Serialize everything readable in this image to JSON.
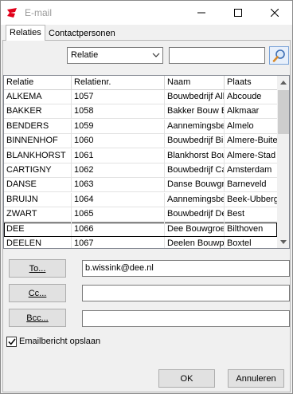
{
  "window": {
    "title": "E-mail",
    "brand_color": "#e2001a"
  },
  "tabs": [
    {
      "label": "Relaties",
      "active": true
    },
    {
      "label": "Contactpersonen",
      "active": false
    }
  ],
  "filter": {
    "field_selected": "Relatie",
    "search_value": ""
  },
  "grid": {
    "columns": [
      "Relatie",
      "Relatienr.",
      "Naam",
      "Plaats"
    ],
    "rows": [
      [
        "ALKEMA",
        "1057",
        "Bouwbedrijf Alk",
        "Abcoude"
      ],
      [
        "BAKKER",
        "1058",
        "Bakker Bouw B.",
        "Alkmaar"
      ],
      [
        "BENDERS",
        "1059",
        "Aannemingsbe",
        "Almelo"
      ],
      [
        "BINNENHOF",
        "1060",
        "Bouwbedrijf Bir",
        "Almere-Buiten"
      ],
      [
        "BLANKHORST",
        "1061",
        "Blankhorst Bou",
        "Almere-Stad"
      ],
      [
        "CARTIGNY",
        "1062",
        "Bouwbedrijf Ca",
        "Amsterdam"
      ],
      [
        "DANSE",
        "1063",
        "Danse Bouwgro",
        "Barneveld"
      ],
      [
        "BRUIJN",
        "1064",
        "Aannemingsbe",
        "Beek-Ubbergen"
      ],
      [
        "ZWART",
        "1065",
        "Bouwbedrijf De",
        "Best"
      ],
      [
        "DEE",
        "1066",
        "Dee Bouwgroe",
        "Bilthoven"
      ],
      [
        "DEELEN",
        "1067",
        "Deelen Bouwpro",
        "Boxtel"
      ]
    ],
    "selected_index": 9
  },
  "recipients": {
    "to_label": "To...",
    "to_value": "b.wissink@dee.nl",
    "cc_label": "Cc...",
    "cc_value": "",
    "bcc_label": "Bcc...",
    "bcc_value": ""
  },
  "save_email": {
    "label": "Emailbericht opslaan",
    "checked": true
  },
  "buttons": {
    "ok": "OK",
    "cancel": "Annuleren"
  }
}
